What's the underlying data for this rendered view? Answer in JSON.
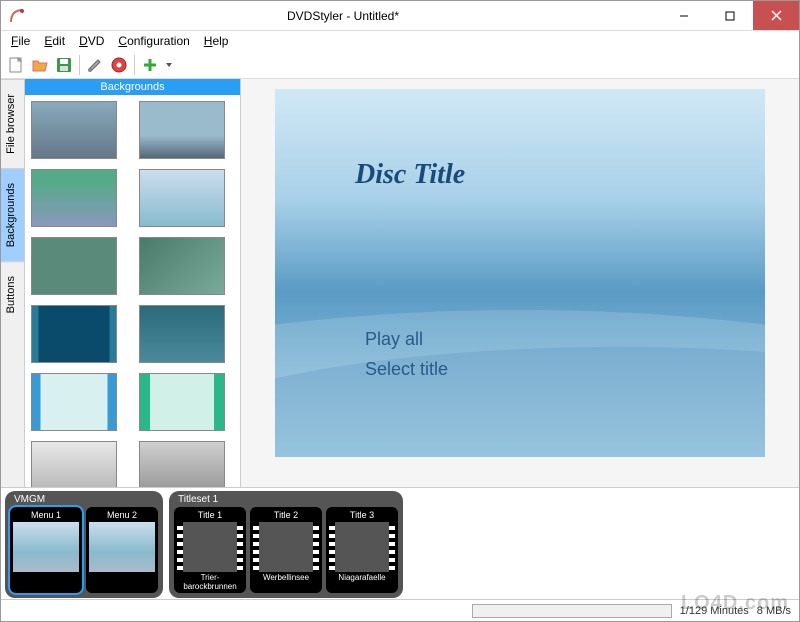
{
  "window": {
    "title": "DVDStyler - Untitled*"
  },
  "menu": {
    "file": "File",
    "edit": "Edit",
    "dvd": "DVD",
    "config": "Configuration",
    "help": "Help"
  },
  "toolbar": {
    "new": "new-file-icon",
    "open": "open-folder-icon",
    "save": "save-icon",
    "wrench": "wrench-icon",
    "burn": "burn-icon",
    "add": "add-icon"
  },
  "side_tabs": {
    "file_browser": "File browser",
    "backgrounds": "Backgrounds",
    "buttons": "Buttons"
  },
  "browser": {
    "header": "Backgrounds"
  },
  "preview": {
    "disc_title": "Disc Title",
    "play_all": "Play all",
    "select_title": "Select title"
  },
  "timeline": {
    "vmgm": {
      "label": "VMGM",
      "items": [
        {
          "label": "Menu 1"
        },
        {
          "label": "Menu 2"
        }
      ]
    },
    "titleset": {
      "label": "Titleset 1",
      "items": [
        {
          "label": "Title 1",
          "caption": "Trier-barockbrunnen"
        },
        {
          "label": "Title 2",
          "caption": "Werbellinsee"
        },
        {
          "label": "Title 3",
          "caption": "Niagarafaelle"
        }
      ]
    }
  },
  "status": {
    "minutes": "1/129 Minutes",
    "rate": "8 MB/s"
  },
  "watermark": "LO4D.com"
}
